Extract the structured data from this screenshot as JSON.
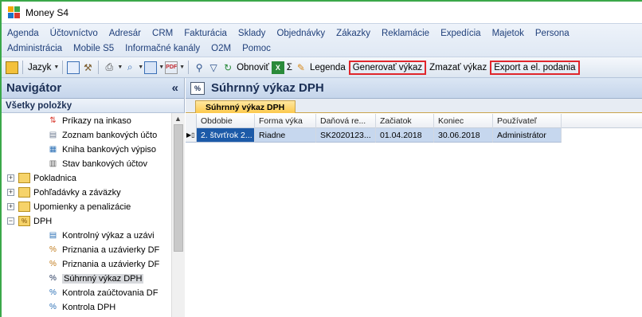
{
  "window": {
    "title": "Money S4"
  },
  "menu": {
    "row1": [
      "Agenda",
      "Účtovníctvo",
      "Adresár",
      "CRM",
      "Fakturácia",
      "Sklady",
      "Objednávky",
      "Zákazky",
      "Reklamácie",
      "Expedícia",
      "Majetok",
      "Persona"
    ],
    "row2": [
      "Administrácia",
      "Mobile S5",
      "Informačné kanály",
      "O2M",
      "Pomoc"
    ]
  },
  "toolbar": {
    "jazyk": "Jazyk",
    "obnovit": "Obnoviť",
    "sigma": "Σ",
    "legenda": "Legenda",
    "generovat": "Generovať výkaz",
    "zmazat": "Zmazať výkaz",
    "export": "Export a el. podania"
  },
  "navigator": {
    "title": "Navigátor",
    "collapse": "«",
    "subtitle": "Všetky položky",
    "items": [
      {
        "label": "Príkazy na inkaso",
        "icon": "payment-order-icon"
      },
      {
        "label": "Zoznam bankových účto",
        "icon": "bank-list-icon"
      },
      {
        "label": "Kniha bankových výpiso",
        "icon": "bank-book-icon"
      },
      {
        "label": "Stav bankových účtov",
        "icon": "bank-state-icon"
      },
      {
        "label": "Pokladnica",
        "icon": "folder-icon",
        "expander": "+"
      },
      {
        "label": "Pohľadávky a záväzky",
        "icon": "folder-icon",
        "expander": "+"
      },
      {
        "label": "Upomienky a penalizácie",
        "icon": "folder-icon",
        "expander": "+"
      },
      {
        "label": "DPH",
        "icon": "folder-dph-icon",
        "expander": "−"
      },
      {
        "label": "Kontrolný výkaz a uzávi",
        "icon": "report-icon"
      },
      {
        "label": "Priznania a uzávierky DF",
        "icon": "tax-return-icon"
      },
      {
        "label": "Priznania a uzávierky DF",
        "icon": "tax-return-icon"
      },
      {
        "label": "Súhrnný výkaz DPH",
        "icon": "percent-icon",
        "selected": true
      },
      {
        "label": "Kontrola zaúčtovania DF",
        "icon": "percent-check-icon"
      },
      {
        "label": "Kontrola DPH",
        "icon": "percent-check-icon"
      }
    ]
  },
  "content": {
    "title": "Súhrnný výkaz DPH",
    "icon_text": "%",
    "tab": "Súhrnný výkaz DPH",
    "columns": [
      "Obdobie",
      "Forma výka",
      "Daňová re...",
      "Začiatok",
      "Koniec",
      "Používateľ"
    ],
    "rows": [
      [
        "2. štvrťrok 2...",
        "Riadne",
        "SK2020123...",
        "01.04.2018",
        "30.06.2018",
        "Administrátor"
      ]
    ],
    "row_indicator": "▶▯"
  }
}
